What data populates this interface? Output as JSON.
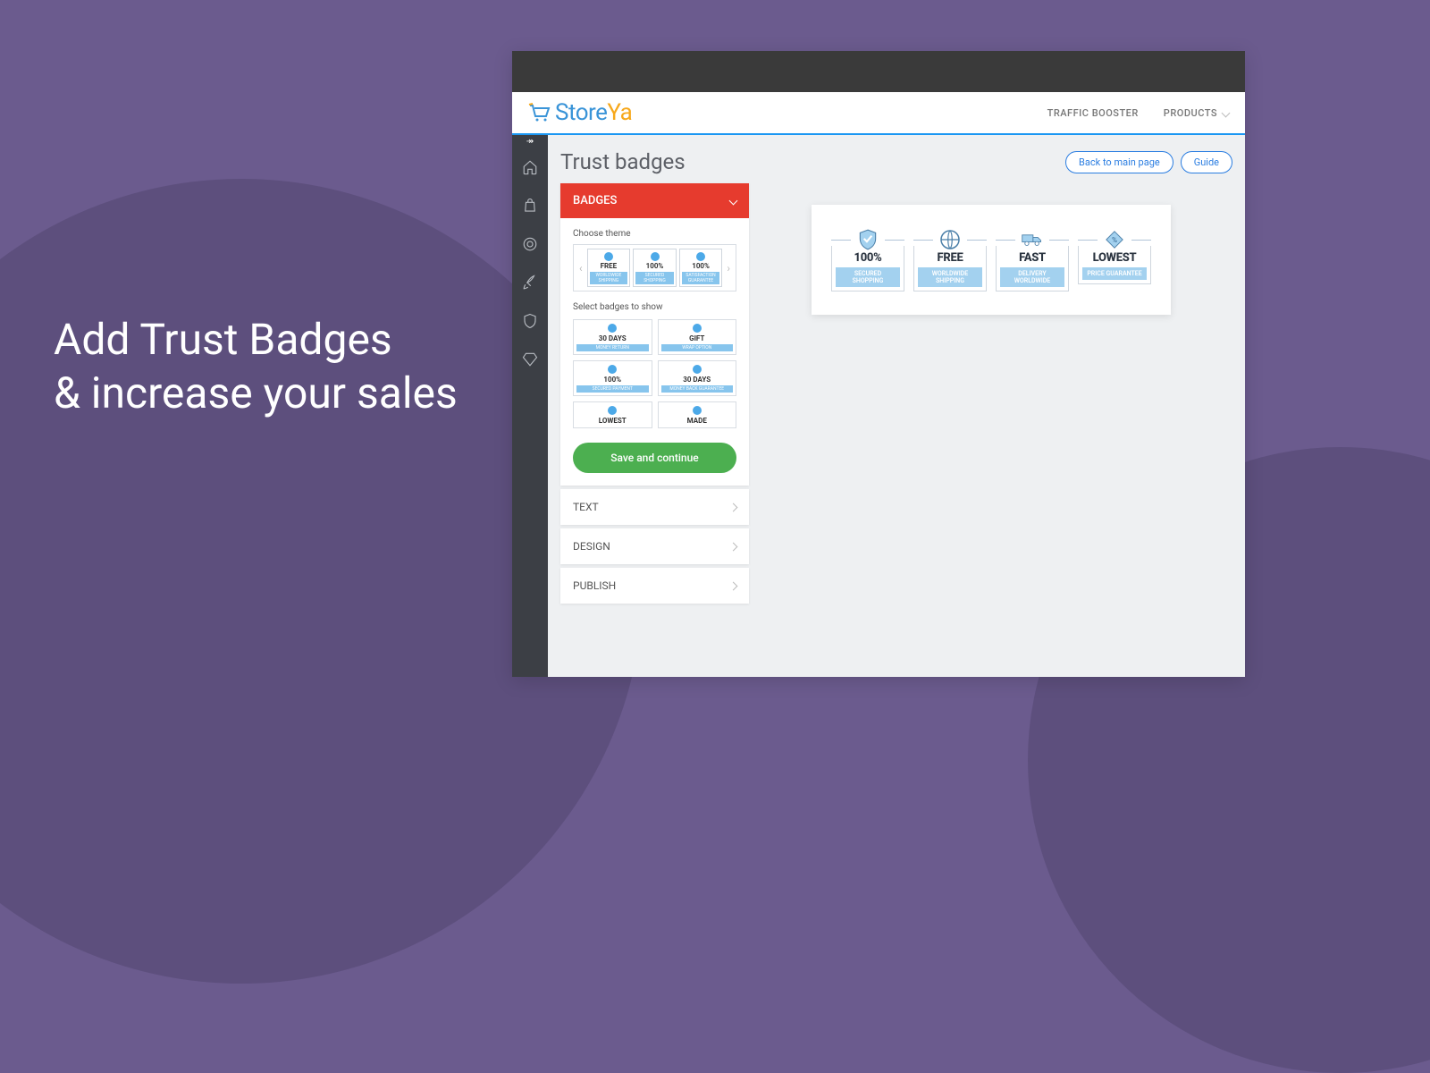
{
  "marketing": {
    "line1": "Add Trust Badges",
    "line2": "& increase your sales"
  },
  "header": {
    "brand_main": "Store",
    "brand_accent": "Ya",
    "nav": {
      "traffic": "TRAFFIC BOOSTER",
      "products": "PRODUCTS"
    }
  },
  "page": {
    "title": "Trust badges",
    "back_btn": "Back to main page",
    "guide_btn": "Guide"
  },
  "panel": {
    "badges_header": "BADGES",
    "choose_theme": "Choose theme",
    "select_badges": "Select badges to show",
    "save_btn": "Save and continue",
    "sections": {
      "text": "TEXT",
      "design": "DESIGN",
      "publish": "PUBLISH"
    },
    "theme_badges": [
      {
        "title": "FREE",
        "sub": "WORLDWIDE SHIPPING"
      },
      {
        "title": "100%",
        "sub": "SECURED SHOPPING"
      },
      {
        "title": "100%",
        "sub": "SATISFACTION GUARANTEE"
      }
    ],
    "select_badges_grid": [
      {
        "title": "30 DAYS",
        "sub": "MONEY RETURN"
      },
      {
        "title": "GIFT",
        "sub": "WRAP OPTION"
      },
      {
        "title": "100%",
        "sub": "SECURED PAYMENT"
      },
      {
        "title": "30 DAYS",
        "sub": "MONEY BACK GUARANTEE"
      },
      {
        "title": "LOWEST",
        "sub": ""
      },
      {
        "title": "MADE",
        "sub": ""
      }
    ]
  },
  "preview": {
    "badges": [
      {
        "title": "100%",
        "sub": "SECURED SHOPPING",
        "icon": "shield"
      },
      {
        "title": "FREE",
        "sub": "WORLDWIDE SHIPPING",
        "icon": "globe"
      },
      {
        "title": "FAST",
        "sub": "DELIVERY WORLDWIDE",
        "icon": "truck"
      },
      {
        "title": "LOWEST",
        "sub": "PRICE GUARANTEE",
        "icon": "tag"
      }
    ]
  }
}
